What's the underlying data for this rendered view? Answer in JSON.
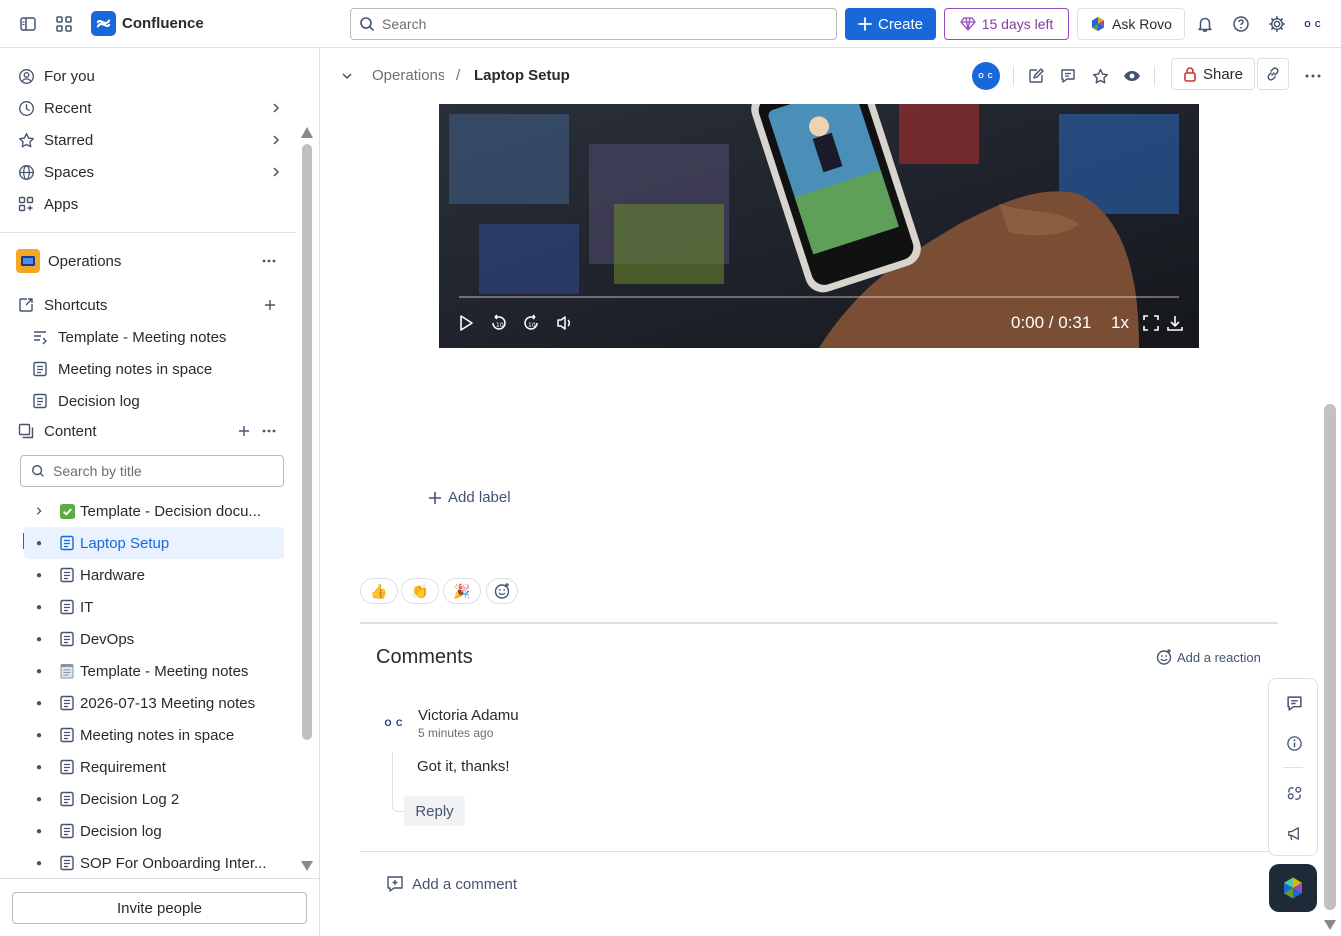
{
  "topbar": {
    "app_name": "Confluence",
    "search_placeholder": "Search",
    "create_label": "Create",
    "trial_label": "15 days left",
    "rovo_label": "Ask Rovo",
    "avatar_text": "O C"
  },
  "sidebar": {
    "nav": [
      {
        "label": "For you",
        "icon": "person-circle-icon"
      },
      {
        "label": "Recent",
        "icon": "clock-icon"
      },
      {
        "label": "Starred",
        "icon": "star-icon"
      },
      {
        "label": "Spaces",
        "icon": "globe-icon"
      },
      {
        "label": "Apps",
        "icon": "apps-icon"
      }
    ],
    "space_name": "Operations",
    "shortcuts_label": "Shortcuts",
    "shortcuts": [
      {
        "label": "Template - Meeting notes"
      },
      {
        "label": "Meeting notes in space"
      },
      {
        "label": "Decision log"
      }
    ],
    "content_label": "Content",
    "search_title_placeholder": "Search by title",
    "tree": [
      {
        "label": "Template - Decision docu...",
        "icon": "check-emoji"
      },
      {
        "label": "Laptop Setup",
        "selected": true
      },
      {
        "label": "Hardware"
      },
      {
        "label": "IT"
      },
      {
        "label": "DevOps"
      },
      {
        "label": "Template - Meeting notes",
        "icon": "notepad-emoji"
      },
      {
        "label": "2026-07-13 Meeting notes"
      },
      {
        "label": "Meeting notes in space"
      },
      {
        "label": "Requirement"
      },
      {
        "label": "Decision Log 2"
      },
      {
        "label": "Decision log"
      },
      {
        "label": "SOP For Onboarding Inter..."
      }
    ],
    "invite_label": "Invite people"
  },
  "page": {
    "breadcrumb_space": "Operations",
    "breadcrumb_sep": "/",
    "title": "Laptop Setup",
    "share_label": "Share",
    "video": {
      "time": "0:00 / 0:31",
      "speed": "1x",
      "progress": 0
    },
    "add_label": "Add label",
    "reactions": [
      "👍",
      "👏",
      "🎉"
    ],
    "comments": {
      "title": "Comments",
      "add_reaction": "Add a reaction",
      "items": [
        {
          "author": "Victoria Adamu",
          "time": "5 minutes ago",
          "text": "Got it, thanks!",
          "reply": "Reply"
        }
      ],
      "add_comment": "Add a comment"
    }
  },
  "colors": {
    "accent": "#1868db",
    "trial": "#803fa5",
    "selected_bg": "#e9f2fe"
  }
}
